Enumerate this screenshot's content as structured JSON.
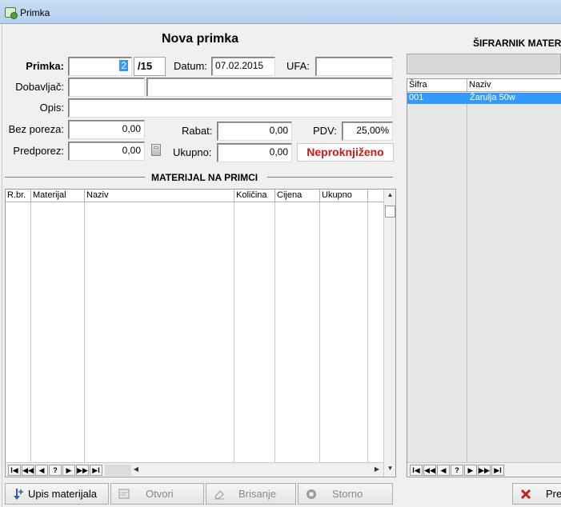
{
  "window": {
    "title": "Primka"
  },
  "form": {
    "heading": "Nova primka",
    "primka_label": "Primka:",
    "primka_value": "2",
    "primka_suffix": "/15",
    "datum_label": "Datum:",
    "datum_value": "07.02.2015",
    "ufa_label": "UFA:",
    "ufa_value": "",
    "dobavljac_label": "Dobavljač:",
    "dobavljac_code": "",
    "dobavljac_name": "",
    "opis_label": "Opis:",
    "opis_value": "",
    "bez_poreza_label": "Bez poreza:",
    "bez_poreza_value": "0,00",
    "rabat_label": "Rabat:",
    "rabat_value": "0,00",
    "pdv_label": "PDV:",
    "pdv_value": "25,00%",
    "predporez_label": "Predporez:",
    "predporez_value": "0,00",
    "ukupno_label": "Ukupno:",
    "ukupno_value": "0,00",
    "status": "Neproknjiženo"
  },
  "materials": {
    "section_title": "MATERIJAL NA PRIMCI",
    "columns": [
      "R.br.",
      "Materijal",
      "Naziv",
      "Količina",
      "Cijena",
      "Ukupno"
    ],
    "rows": []
  },
  "navigator": [
    "I◀",
    "◀◀",
    "◀",
    "?",
    "▶",
    "▶▶",
    "▶I"
  ],
  "catalog": {
    "title": "ŠIFRARNIK MATERIJALA",
    "search_value": "",
    "columns": [
      "Šifra",
      "Naziv"
    ],
    "rows": [
      {
        "sifra": "001",
        "naziv": "Žarulja 50w"
      }
    ]
  },
  "buttons": {
    "upis": "Upis materijala",
    "otvori": "Otvori",
    "brisanje": "Brisanje",
    "storno": "Storno",
    "pregled": "Pre"
  },
  "colors": {
    "status_red": "#d11818",
    "selection_blue": "#3399ff"
  }
}
